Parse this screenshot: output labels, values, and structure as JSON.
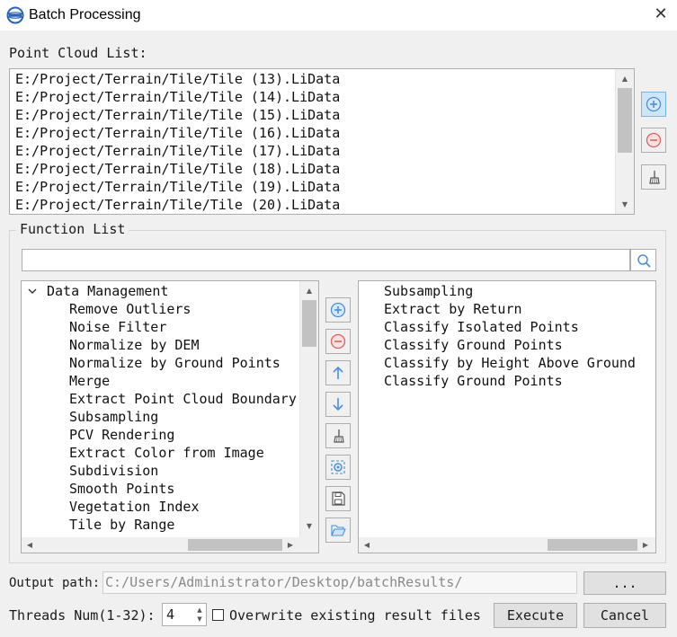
{
  "window": {
    "title": "Batch Processing"
  },
  "point_cloud": {
    "label": "Point Cloud List:",
    "items": [
      "E:/Project/Terrain/Tile/Tile (13).LiData",
      "E:/Project/Terrain/Tile/Tile (14).LiData",
      "E:/Project/Terrain/Tile/Tile (15).LiData",
      "E:/Project/Terrain/Tile/Tile (16).LiData",
      "E:/Project/Terrain/Tile/Tile (17).LiData",
      "E:/Project/Terrain/Tile/Tile (18).LiData",
      "E:/Project/Terrain/Tile/Tile (19).LiData",
      "E:/Project/Terrain/Tile/Tile (20).LiData"
    ]
  },
  "function_list": {
    "label": "Function List",
    "search_value": "",
    "tree_root": "Data Management",
    "tree_items": [
      "Remove Outliers",
      "Noise Filter",
      "Normalize by DEM",
      "Normalize by Ground Points",
      "Merge",
      "Extract Point Cloud Boundary",
      "Subsampling",
      "PCV Rendering",
      "Extract Color from Image",
      "Subdivision",
      "Smooth Points",
      "Vegetation Index",
      "Tile by Range"
    ],
    "selected_items": [
      "Subsampling",
      "Extract by Return",
      "Classify Isolated Points",
      "Classify Ground Points",
      "Classify by Height Above Ground",
      "Classify Ground Points"
    ]
  },
  "output": {
    "label": "Output path:",
    "value": "C:/Users/Administrator/Desktop/batchResults/",
    "browse_label": "..."
  },
  "threads": {
    "label": "Threads Num(1-32):",
    "value": "4"
  },
  "overwrite": {
    "label": "Overwrite existing result files",
    "checked": false
  },
  "actions": {
    "execute_label": "Execute",
    "cancel_label": "Cancel"
  },
  "colors": {
    "accent_blue": "#4a90d9",
    "danger_red": "#e06060",
    "scroll_thumb": "#c2c2c2"
  }
}
